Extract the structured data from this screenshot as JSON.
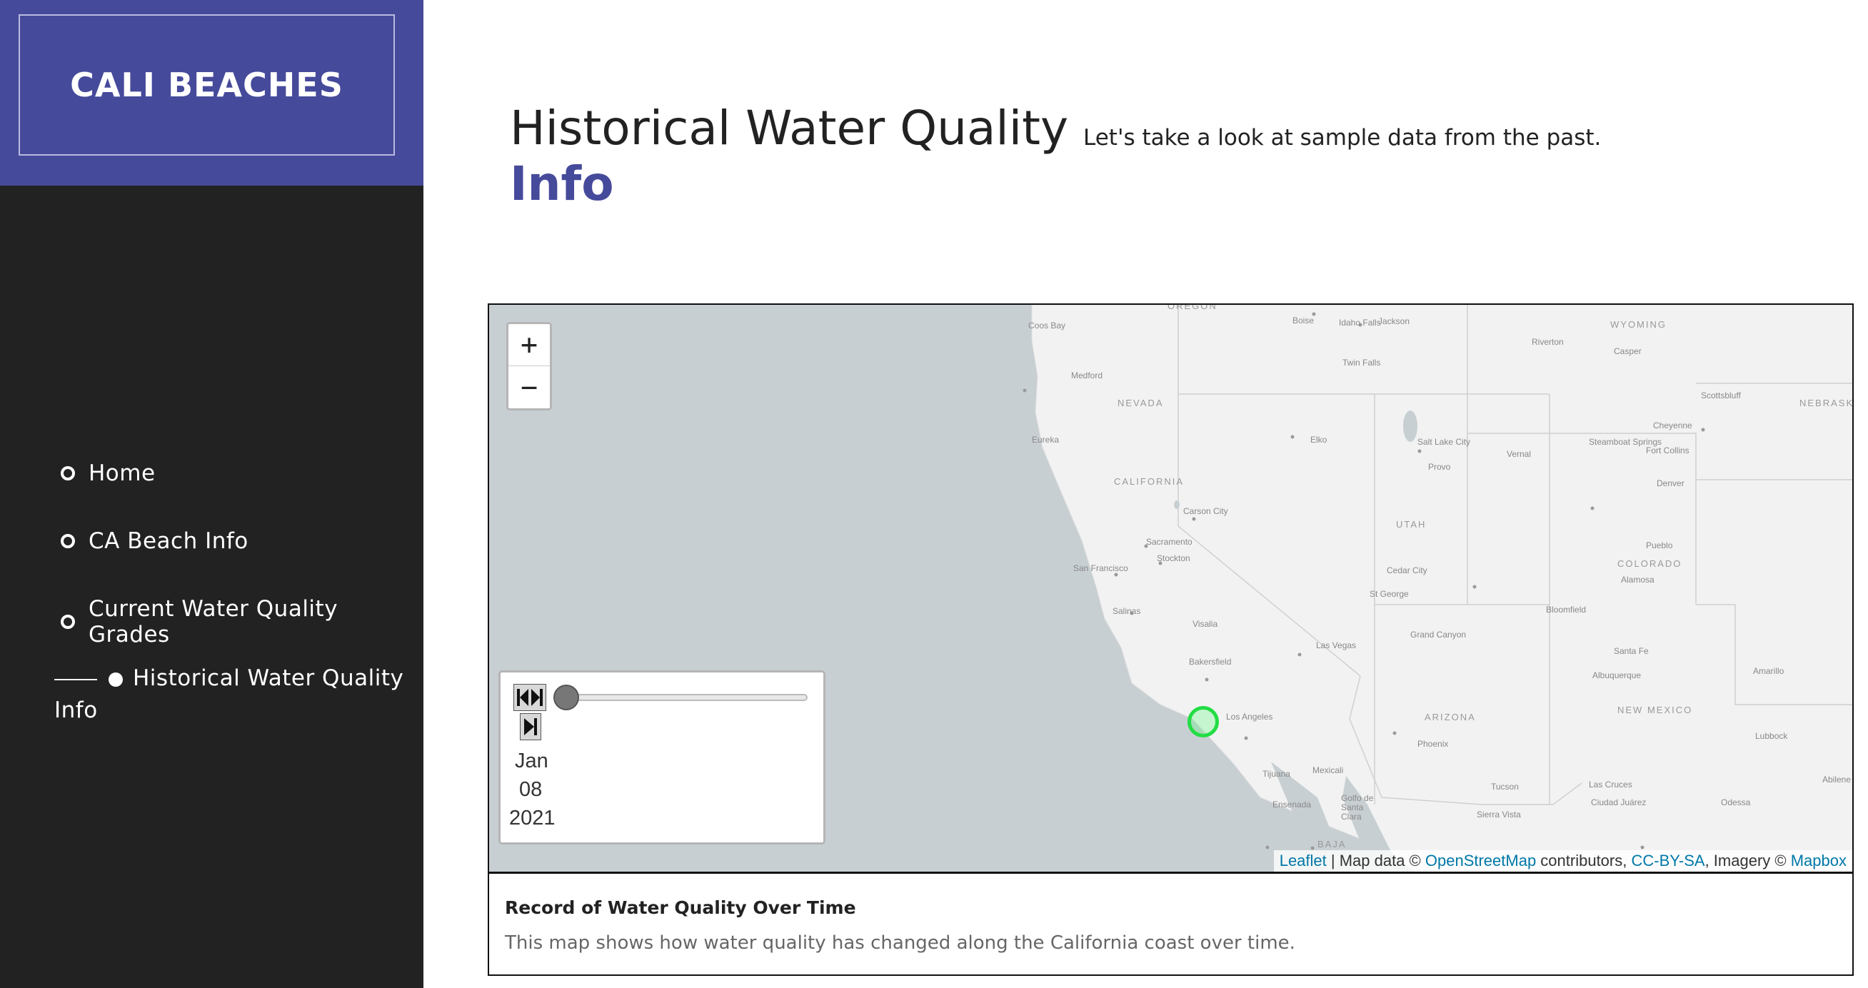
{
  "brand": {
    "title": "CALI BEACHES"
  },
  "nav": {
    "items": [
      {
        "label": "Home"
      },
      {
        "label": "CA Beach Info"
      },
      {
        "label": "Current Water Quality Grades"
      },
      {
        "label": "Historical Water Quality Info"
      }
    ]
  },
  "header": {
    "title": "Historical Water Quality",
    "title_accent": "Info",
    "subtitle": "Let's take a look at sample data from the past."
  },
  "map": {
    "zoom_in": "+",
    "zoom_out": "−",
    "timeline": {
      "month": "Jan",
      "day": "08",
      "year": "2021",
      "slider_position": 0
    },
    "attribution": {
      "leaflet": "Leaflet",
      "sep1": " | Map data © ",
      "osm": "OpenStreetMap",
      "sep2": " contributors, ",
      "license": "CC-BY-SA",
      "sep3": ", Imagery © ",
      "mapbox": "Mapbox"
    },
    "marker_color": "#22dd44",
    "labels": {
      "states": [
        "NEVADA",
        "CALIFORNIA",
        "UTAH",
        "ARIZONA",
        "COLORADO",
        "WYOMING",
        "NEBRASKA",
        "NEW MEXICO",
        "BAJA",
        "OREGON"
      ],
      "cities": [
        "Boise",
        "Idaho Falls",
        "Jackson",
        "Riverton",
        "Casper",
        "Twin Falls",
        "Medford",
        "Eureka",
        "Elko",
        "Salt Lake City",
        "Provo",
        "Vernal",
        "Steamboat Springs",
        "Fort Collins",
        "Denver",
        "Cheyenne",
        "Scottsbluff",
        "Carson City",
        "Sacramento",
        "Stockton",
        "San Francisco",
        "Salinas",
        "Visalia",
        "Bakersfield",
        "Las Vegas",
        "Cedar City",
        "St George",
        "Grand Canyon",
        "Pueblo",
        "Alamosa",
        "Bloomfield",
        "Santa Fe",
        "Albuquerque",
        "Amarillo",
        "Los Angeles",
        "Tijuana",
        "Mexicali",
        "Ensenada",
        "Golfo de Santa Clara",
        "Phoenix",
        "Tucson",
        "Las Cruces",
        "Ciudad Juárez",
        "Odessa",
        "Lubbock",
        "Sierra Vista",
        "Abilene",
        "Coos Bay"
      ]
    }
  },
  "caption": {
    "title": "Record of Water Quality Over Time",
    "text": "This map shows how water quality has changed along the California coast over time."
  }
}
